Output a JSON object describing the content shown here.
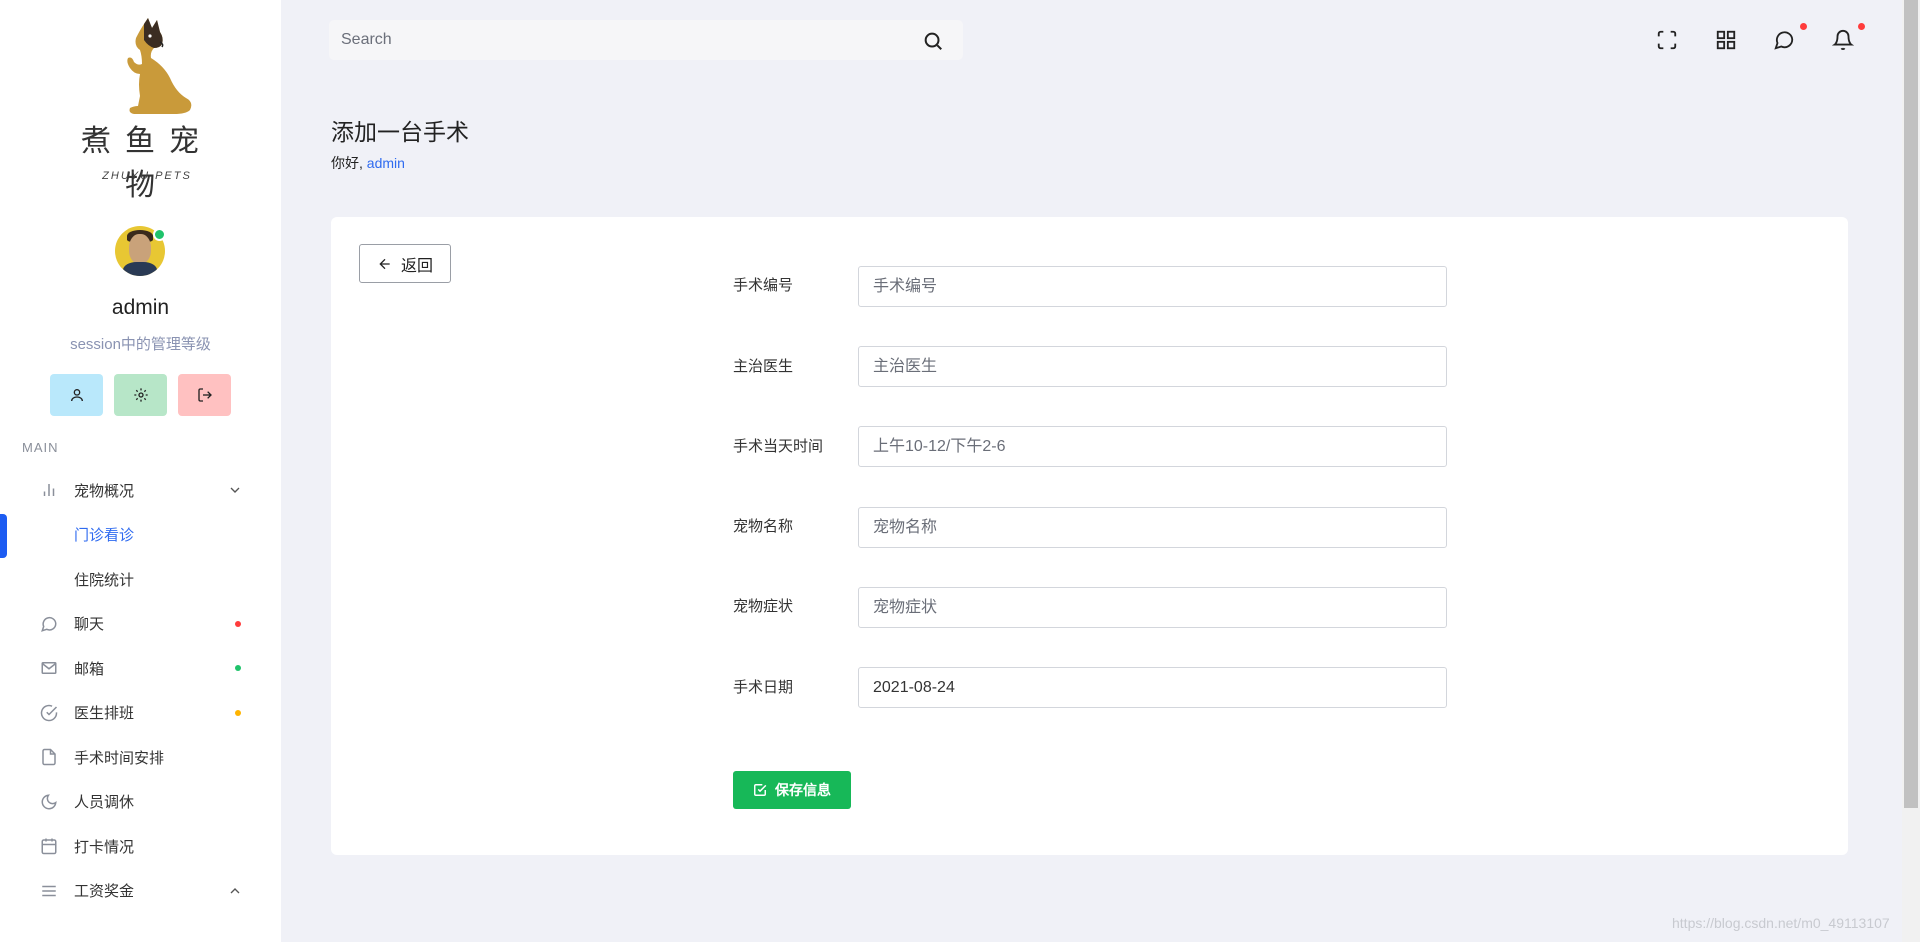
{
  "brand": {
    "title": "煮鱼宠物",
    "subtitle": "ZHUYU PETS"
  },
  "user": {
    "name": "admin",
    "role": "session中的管理等级"
  },
  "sidebar": {
    "section_label": "MAIN",
    "items": [
      {
        "label": "宠物概况",
        "icon": "bar-chart-icon"
      },
      {
        "label": "门诊看诊"
      },
      {
        "label": "住院统计"
      },
      {
        "label": "聊天",
        "icon": "chat-icon",
        "dot_color": "#ff3c3c"
      },
      {
        "label": "邮箱",
        "icon": "mail-icon",
        "dot_color": "#1fc36b"
      },
      {
        "label": "医生排班",
        "icon": "check-circle-icon",
        "dot_color": "#ffb400"
      },
      {
        "label": "手术时间安排",
        "icon": "file-icon"
      },
      {
        "label": "人员调休",
        "icon": "moon-icon"
      },
      {
        "label": "打卡情况",
        "icon": "calendar-icon"
      },
      {
        "label": "工资奖金",
        "icon": "menu-icon"
      }
    ]
  },
  "header": {
    "search_placeholder": "Search"
  },
  "page": {
    "title": "添加一台手术",
    "greeting_prefix": "你好, ",
    "greeting_user": "admin"
  },
  "form": {
    "back_label": "返回",
    "fields": [
      {
        "label": "手术编号",
        "placeholder": "手术编号",
        "value": ""
      },
      {
        "label": "主治医生",
        "placeholder": "主治医生",
        "value": ""
      },
      {
        "label": "手术当天时间",
        "placeholder": "上午10-12/下午2-6",
        "value": ""
      },
      {
        "label": "宠物名称",
        "placeholder": "宠物名称",
        "value": ""
      },
      {
        "label": "宠物症状",
        "placeholder": "宠物症状",
        "value": ""
      },
      {
        "label": "手术日期",
        "placeholder": "",
        "value": "2021-08-24"
      }
    ],
    "save_label": "保存信息"
  },
  "watermark": "https://blog.csdn.net/m0_49113107",
  "colors": {
    "accent": "#2f6bf0",
    "success": "#17b858",
    "background": "#f0f1f7"
  }
}
